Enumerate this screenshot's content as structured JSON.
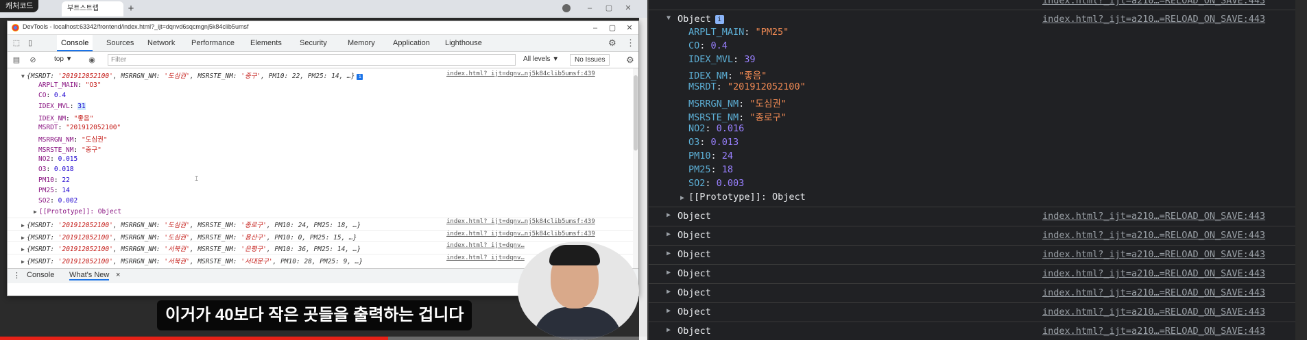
{
  "browser": {
    "channel_label": "캐처코드",
    "tab_title": "부트스트랩",
    "new_tab": "+"
  },
  "devtools": {
    "window_title": "DevTools - localhost:63342/frontend/index.html?_ijt=dqnvd6sqcmgnj5k84clib5umsf",
    "tabs": [
      "Console",
      "Sources",
      "Network",
      "Performance",
      "Elements",
      "Security",
      "Memory",
      "Application",
      "Lighthouse"
    ],
    "active_tab": "Console",
    "context": "top ▼",
    "filter_placeholder": "Filter",
    "levels": "All levels ▼",
    "no_issues": "No Issues",
    "drawer_tabs": [
      "Console",
      "What's New"
    ],
    "drawer_close": "×",
    "expanded_entry": {
      "summary_prefix": "{MSRDT: ",
      "summary_msrdt": "'201912052100'",
      "summary_mid1": ", MSRRGN_NM: ",
      "summary_rgn": "'도심권'",
      "summary_mid2": ", MSRSTE_NM: ",
      "summary_ste": "'중구'",
      "summary_rest": ", PM10: 22, PM25: 14, …}",
      "source": "index.html?_ijt=dqnv…nj5k84clib5umsf:439",
      "props": [
        {
          "key": "ARPLT_MAIN",
          "value": "\"O3\"",
          "kind": "str"
        },
        {
          "key": "CO",
          "value": "0.4",
          "kind": "num"
        },
        {
          "key": "IDEX_MVL",
          "value": "31",
          "kind": "num"
        },
        {
          "key": "IDEX_NM",
          "value": "\"좋음\"",
          "kind": "str"
        },
        {
          "key": "MSRDT",
          "value": "\"201912052100\"",
          "kind": "str"
        },
        {
          "key": "MSRRGN_NM",
          "value": "\"도심권\"",
          "kind": "str"
        },
        {
          "key": "MSRSTE_NM",
          "value": "\"중구\"",
          "kind": "str"
        },
        {
          "key": "NO2",
          "value": "0.015",
          "kind": "num"
        },
        {
          "key": "O3",
          "value": "0.018",
          "kind": "num"
        },
        {
          "key": "PM10",
          "value": "22",
          "kind": "num"
        },
        {
          "key": "PM25",
          "value": "14",
          "kind": "num"
        },
        {
          "key": "SO2",
          "value": "0.002",
          "kind": "num"
        }
      ],
      "prototype": "[[Prototype]]: Object"
    },
    "collapsed_entries": [
      {
        "rgn": "'도심권'",
        "ste": "'종로구'",
        "rest": ", PM10: 24, PM25: 18, …}",
        "source": "index.html?_ijt=dqnv…nj5k84clib5umsf:439"
      },
      {
        "rgn": "'도심권'",
        "ste": "'용산구'",
        "rest": ", PM10: 0, PM25: 15, …}",
        "source": "index.html?_ijt=dqnv…nj5k84clib5umsf:439"
      },
      {
        "rgn": "'서북권'",
        "ste": "'은평구'",
        "rest": ", PM10: 36, PM25: 14, …}",
        "source": "index.html?_ijt=dqnv…"
      },
      {
        "rgn": "'서북권'",
        "ste": "'서대문구'",
        "rest": ", PM10: 28, PM25: 9, …}",
        "source": "index.html?_ijt=dqnv…"
      }
    ],
    "collapsed_msrdt": "'201912052100'"
  },
  "subtitle": "이거가 40보다 작은 곳들을 출력하는 겁니다",
  "progress_fraction": 0.6,
  "right_console": {
    "top_source": "index.html?_ijt=a210…=RELOAD_ON_SAVE:443",
    "expanded": {
      "label": "Object",
      "info": "i",
      "source": "index.html?_ijt=a210…=RELOAD_ON_SAVE:443",
      "props": [
        {
          "key": "ARPLT_MAIN",
          "value": "\"PM25\"",
          "kind": "str"
        },
        {
          "key": "CO",
          "value": "0.4",
          "kind": "num"
        },
        {
          "key": "IDEX_MVL",
          "value": "39",
          "kind": "num"
        },
        {
          "key": "IDEX_NM",
          "value": "\"좋음\"",
          "kind": "str"
        },
        {
          "key": "MSRDT",
          "value": "\"201912052100\"",
          "kind": "str"
        },
        {
          "key": "MSRRGN_NM",
          "value": "\"도심권\"",
          "kind": "str"
        },
        {
          "key": "MSRSTE_NM",
          "value": "\"종로구\"",
          "kind": "str"
        },
        {
          "key": "NO2",
          "value": "0.016",
          "kind": "num"
        },
        {
          "key": "O3",
          "value": "0.013",
          "kind": "num"
        },
        {
          "key": "PM10",
          "value": "24",
          "kind": "num"
        },
        {
          "key": "PM25",
          "value": "18",
          "kind": "num"
        },
        {
          "key": "SO2",
          "value": "0.003",
          "kind": "num"
        }
      ],
      "prototype": "[[Prototype]]: Object"
    },
    "collapsed": [
      {
        "label": "Object",
        "source": "index.html?_ijt=a210…=RELOAD_ON_SAVE:443"
      },
      {
        "label": "Object",
        "source": "index.html?_ijt=a210…=RELOAD_ON_SAVE:443"
      },
      {
        "label": "Object",
        "source": "index.html?_ijt=a210…=RELOAD_ON_SAVE:443"
      },
      {
        "label": "Object",
        "source": "index.html?_ijt=a210…=RELOAD_ON_SAVE:443"
      },
      {
        "label": "Object",
        "source": "index.html?_ijt=a210…=RELOAD_ON_SAVE:443"
      },
      {
        "label": "Object",
        "source": "index.html?_ijt=a210…=RELOAD_ON_SAVE:443"
      },
      {
        "label": "Object",
        "source": "index.html?_ijt=a210…=RELOAD_ON_SAVE:443"
      }
    ]
  },
  "colors": {
    "dark_bg": "#202124",
    "key_blue": "#5db0d7",
    "string_orange": "#f28b54",
    "number_purple": "#9980ff",
    "progress_red": "#e62117"
  }
}
